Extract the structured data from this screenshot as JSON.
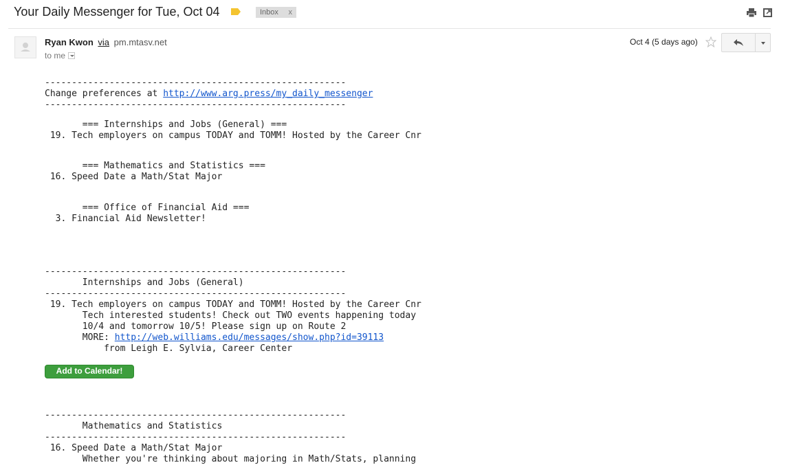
{
  "header": {
    "subject": "Your Daily Messenger for Tue, Oct 04",
    "label_icon": "label-tag-icon",
    "inbox_label": "Inbox",
    "inbox_remove": "x",
    "print_icon": "print-icon",
    "new_window_icon": "new-window-icon"
  },
  "message": {
    "sender_name": "Ryan Kwon",
    "via_text": "via",
    "via_domain": "pm.mtasv.net",
    "to_text": "to me",
    "date": "Oct 4 (5 days ago)",
    "star_icon": "star-icon",
    "reply_icon": "reply-icon",
    "more_icon": "chevron-down-icon"
  },
  "body": {
    "sep1": "--------------------------------------------------------",
    "prefs_text": "Change preferences at ",
    "prefs_link": "http://www.arg.press/my_daily_messenger",
    "sep2": "--------------------------------------------------------",
    "toc_heading_1": "       === Internships and Jobs (General) ===",
    "toc_item_1": " 19. Tech employers on campus TODAY and TOMM! Hosted by the Career Cnr",
    "toc_heading_2": "       === Mathematics and Statistics ===",
    "toc_item_2": " 16. Speed Date a Math/Stat Major",
    "toc_heading_3": "       === Office of Financial Aid ===",
    "toc_item_3": "  3. Financial Aid Newsletter!",
    "sep3": "--------------------------------------------------------",
    "section_1_title": "       Internships and Jobs (General)",
    "sep4": "--------------------------------------------------------",
    "s1_item_title": " 19. Tech employers on campus TODAY and TOMM! Hosted by the Career Cnr",
    "s1_line_1": "       Tech interested students! Check out TWO events happening today",
    "s1_line_2": "       10/4 and tomorrow 10/5! Please sign up on Route 2",
    "s1_more_label": "       MORE: ",
    "s1_more_link": "http://web.williams.edu/messages/show.php?id=39113",
    "s1_from": "           from Leigh E. Sylvia, Career Center",
    "calendar_button": "Add to Calendar!",
    "sep5": "--------------------------------------------------------",
    "section_2_title": "       Mathematics and Statistics",
    "sep6": "--------------------------------------------------------",
    "s2_item_title": " 16. Speed Date a Math/Stat Major",
    "s2_line_1": "       Whether you're thinking about majoring in Math/Stats, planning"
  },
  "colors": {
    "link": "#1155cc",
    "label_yellow": "#f4c430",
    "calendar_green": "#3d9e3d",
    "inbox_chip_bg": "#dddddd"
  }
}
